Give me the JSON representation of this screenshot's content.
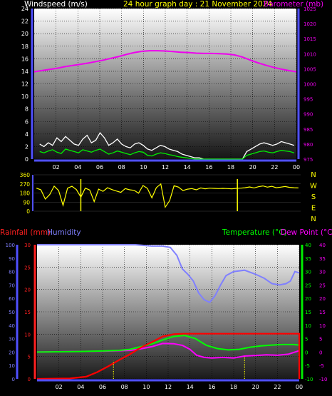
{
  "header": {
    "windspeed_label": "Windspeed (m/s)",
    "title": "24 hour graph day : 21 November 2024",
    "barometer_label": "Barometer (mb)",
    "rainfall_label": "Rainfall (mm)",
    "humidity_label": "Humidity",
    "temperature_label": "Temperature (°C)",
    "dewpoint_label": "Dew Point (°C)"
  },
  "colors": {
    "wind": "#ffffff",
    "gust": "#00ee00",
    "barometer": "#ee00ee",
    "wind_direction": "#ffff00",
    "rainfall": "#ff0000",
    "humidity": "#8080ff",
    "temperature": "#00ff00",
    "dewpoint": "#ff00ff",
    "rain_bar": "#ffff00"
  },
  "chart_data": [
    {
      "type": "line",
      "name": "wind-baro",
      "x_ticks": [
        "02",
        "04",
        "06",
        "08",
        "10",
        "12",
        "14",
        "16",
        "18",
        "20",
        "22",
        "00"
      ],
      "ylim_left": [
        0,
        24
      ],
      "yticks_left": [
        0,
        2,
        4,
        6,
        8,
        10,
        12,
        14,
        16,
        18,
        20,
        22,
        24
      ],
      "ylim_right": [
        975,
        1025
      ],
      "yticks_right": [
        975,
        980,
        985,
        990,
        995,
        1000,
        1005,
        1010,
        1015,
        1020,
        1025
      ],
      "wind_avg": [
        1.2,
        1.0,
        1.3,
        1.5,
        1.1,
        0.9,
        1.6,
        1.4,
        1.2,
        1.0,
        1.5,
        1.3,
        1.1,
        1.4,
        1.6,
        1.2,
        0.8,
        1.0,
        1.3,
        1.1,
        0.9,
        0.7,
        1.0,
        1.2,
        1.1,
        0.6,
        0.5,
        0.8,
        1.0,
        0.9,
        0.7,
        0.6,
        0.4,
        0.3,
        0.2,
        0.1,
        0,
        0,
        0,
        0,
        0,
        0,
        0,
        0,
        0,
        0,
        0,
        0,
        0.6,
        0.8,
        1.0,
        1.2,
        1.3,
        1.1,
        1.0,
        1.2,
        1.4,
        1.3,
        1.2,
        1.0
      ],
      "wind_gust": [
        2.4,
        2.0,
        2.6,
        2.2,
        3.4,
        2.8,
        3.6,
        3.0,
        2.4,
        2.2,
        3.2,
        3.8,
        2.6,
        3.0,
        4.2,
        3.4,
        2.2,
        2.6,
        3.2,
        2.4,
        2.0,
        1.8,
        2.4,
        2.6,
        2.2,
        1.6,
        1.4,
        1.8,
        2.2,
        2.0,
        1.6,
        1.4,
        1.2,
        0.8,
        0.6,
        0.4,
        0.2,
        0.2,
        0,
        0,
        0,
        0,
        0,
        0,
        0,
        0,
        0,
        0,
        1.2,
        1.6,
        2.0,
        2.4,
        2.6,
        2.4,
        2.2,
        2.4,
        2.8,
        2.6,
        2.4,
        2.2
      ],
      "barometer": [
        1004.0,
        1004.4,
        1004.8,
        1005.2,
        1005.7,
        1006.1,
        1006.5,
        1006.9,
        1007.4,
        1007.9,
        1008.5,
        1009.1,
        1009.8,
        1010.4,
        1010.8,
        1011.0,
        1011.0,
        1010.9,
        1010.7,
        1010.5,
        1010.4,
        1010.2,
        1010.1,
        1010.1,
        1010.0,
        1009.9,
        1009.6,
        1008.9,
        1007.9,
        1007.0,
        1006.2,
        1005.5,
        1004.9,
        1004.4,
        1004.0
      ]
    },
    {
      "type": "scatter",
      "name": "wind-direction",
      "x_ticks": [
        "02",
        "04",
        "06",
        "08",
        "10",
        "12",
        "14",
        "16",
        "18",
        "20",
        "22",
        "00"
      ],
      "ylim": [
        0,
        360
      ],
      "yticks": [
        0,
        90,
        180,
        270,
        360
      ],
      "compass": [
        "N",
        "W",
        "S",
        "E",
        "N"
      ],
      "direction": [
        228,
        212,
        120,
        165,
        248,
        204,
        58,
        228,
        246,
        214,
        140,
        228,
        210,
        95,
        218,
        196,
        232,
        214,
        200,
        186,
        224,
        212,
        206,
        178,
        254,
        226,
        132,
        232,
        270,
        40,
        104,
        252,
        238,
        204,
        218,
        224,
        212,
        230,
        222,
        228,
        226,
        224,
        226,
        224,
        222,
        226,
        228,
        232,
        240,
        230,
        242,
        250,
        238,
        246,
        232,
        238,
        244,
        236,
        232,
        230
      ],
      "rain_events": [
        4.2,
        18.3
      ]
    },
    {
      "type": "line",
      "name": "rain-humidity-temp",
      "x_ticks": [
        "02",
        "04",
        "06",
        "08",
        "10",
        "12",
        "14",
        "16",
        "18",
        "20",
        "22",
        "00"
      ],
      "ylim_rain": [
        0,
        30
      ],
      "yticks_rain": [
        0,
        5,
        10,
        15,
        20,
        25,
        30
      ],
      "ylim_humidity": [
        0,
        100
      ],
      "yticks_humidity": [
        0,
        10,
        20,
        30,
        40,
        50,
        60,
        70,
        80,
        90,
        100
      ],
      "ylim_temp": [
        -10,
        40
      ],
      "yticks_temp": [
        -10,
        -5,
        0,
        5,
        10,
        15,
        20,
        25,
        30,
        35,
        40
      ],
      "humidity": [
        [
          0,
          100
        ],
        [
          9,
          100
        ],
        [
          10.5,
          99
        ],
        [
          11.5,
          99
        ],
        [
          12.2,
          98
        ],
        [
          12.8,
          92
        ],
        [
          13.3,
          82
        ],
        [
          13.8,
          78
        ],
        [
          14.3,
          73
        ],
        [
          14.8,
          64
        ],
        [
          15.3,
          59
        ],
        [
          15.8,
          57
        ],
        [
          16.3,
          62
        ],
        [
          16.8,
          70
        ],
        [
          17.3,
          77
        ],
        [
          18.0,
          80
        ],
        [
          19.0,
          81
        ],
        [
          20.0,
          78
        ],
        [
          20.8,
          75
        ],
        [
          21.5,
          71
        ],
        [
          22.2,
          70
        ],
        [
          22.8,
          71
        ],
        [
          23.2,
          73
        ],
        [
          23.6,
          80
        ],
        [
          24,
          79
        ]
      ],
      "rainfall": [
        [
          0,
          0
        ],
        [
          3,
          0.1
        ],
        [
          4.5,
          0.5
        ],
        [
          5.5,
          1.5
        ],
        [
          6.5,
          2.8
        ],
        [
          7.5,
          4.2
        ],
        [
          8.5,
          5.5
        ],
        [
          9.5,
          7.0
        ],
        [
          10.5,
          8.2
        ],
        [
          11.5,
          9.5
        ],
        [
          12.5,
          10.0
        ],
        [
          13.5,
          10.1
        ],
        [
          14,
          10.1
        ],
        [
          24,
          10.1
        ]
      ],
      "temperature": [
        [
          0,
          0
        ],
        [
          2,
          0.1
        ],
        [
          4,
          0.2
        ],
        [
          6,
          0.4
        ],
        [
          7.5,
          0.6
        ],
        [
          8.5,
          1.0
        ],
        [
          9.5,
          2.0
        ],
        [
          10.5,
          3.0
        ],
        [
          11.5,
          4.5
        ],
        [
          12.5,
          5.8
        ],
        [
          13.5,
          6.2
        ],
        [
          14.5,
          5.0
        ],
        [
          15.5,
          2.5
        ],
        [
          16.5,
          1.3
        ],
        [
          17.5,
          0.8
        ],
        [
          18.5,
          1.0
        ],
        [
          19.5,
          1.8
        ],
        [
          20.5,
          2.3
        ],
        [
          21.5,
          2.6
        ],
        [
          22.5,
          2.8
        ],
        [
          23.5,
          2.8
        ],
        [
          24,
          2.6
        ]
      ],
      "dewpoint": [
        [
          0,
          0
        ],
        [
          3,
          0.2
        ],
        [
          6,
          0.3
        ],
        [
          8.5,
          0.6
        ],
        [
          9.5,
          1.2
        ],
        [
          10.5,
          2.0
        ],
        [
          11.5,
          3.2
        ],
        [
          12.5,
          3.1
        ],
        [
          13.3,
          2.5
        ],
        [
          14.0,
          1.0
        ],
        [
          14.6,
          -1.2
        ],
        [
          15.3,
          -2.0
        ],
        [
          16,
          -2.2
        ],
        [
          17,
          -2.0
        ],
        [
          18,
          -2.2
        ],
        [
          19,
          -1.5
        ],
        [
          20,
          -1.3
        ],
        [
          21,
          -1.0
        ],
        [
          22,
          -1.2
        ],
        [
          23,
          -0.8
        ],
        [
          23.6,
          0
        ],
        [
          24,
          0.5
        ]
      ],
      "rain_marks": [
        [
          7.0,
          4.0
        ],
        [
          19.0,
          5.0
        ]
      ]
    }
  ]
}
